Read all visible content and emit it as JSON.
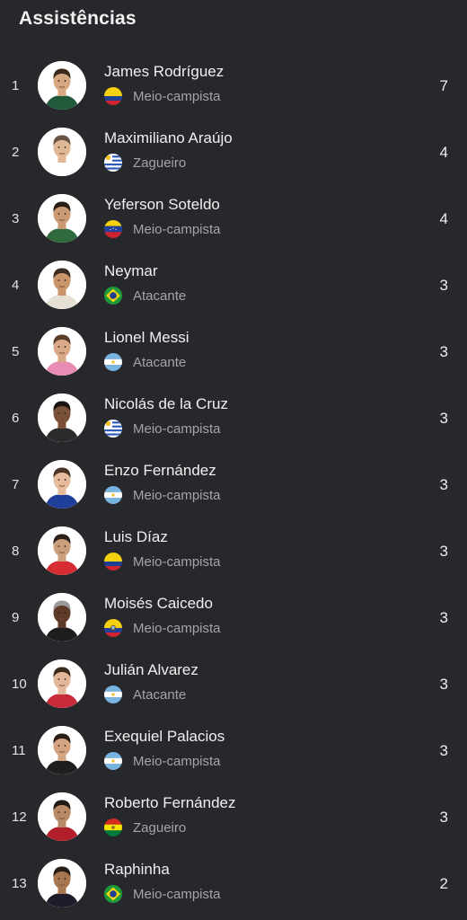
{
  "header": {
    "title": "Assistências"
  },
  "players": [
    {
      "rank": "1",
      "name": "James Rodríguez",
      "position": "Meio-campista",
      "value": "7",
      "country": "colombia",
      "avatar": {
        "skin": "#d7a982",
        "hair": "#3a2a1e",
        "shirt": "#1f5b3a"
      }
    },
    {
      "rank": "2",
      "name": "Maximiliano Araújo",
      "position": "Zagueiro",
      "value": "4",
      "country": "uruguay",
      "avatar": {
        "skin": "#e0b896",
        "hair": "#6b5444",
        "shirt": "#ffffff"
      }
    },
    {
      "rank": "3",
      "name": "Yeferson Soteldo",
      "position": "Meio-campista",
      "value": "4",
      "country": "venezuela",
      "avatar": {
        "skin": "#c99a74",
        "hair": "#2a1e16",
        "shirt": "#2e6a3c"
      }
    },
    {
      "rank": "4",
      "name": "Neymar",
      "position": "Atacante",
      "value": "3",
      "country": "brazil",
      "avatar": {
        "skin": "#c9966c",
        "hair": "#3b2b20",
        "shirt": "#e6e0d4"
      }
    },
    {
      "rank": "5",
      "name": "Lionel Messi",
      "position": "Atacante",
      "value": "3",
      "country": "argentina",
      "avatar": {
        "skin": "#d9a886",
        "hair": "#5a3e2a",
        "shirt": "#e98cb4"
      }
    },
    {
      "rank": "6",
      "name": "Nicolás de la Cruz",
      "position": "Meio-campista",
      "value": "3",
      "country": "uruguay",
      "avatar": {
        "skin": "#7a5138",
        "hair": "#1c1410",
        "shirt": "#2a2a2a"
      }
    },
    {
      "rank": "7",
      "name": "Enzo Fernández",
      "position": "Meio-campista",
      "value": "3",
      "country": "argentina",
      "avatar": {
        "skin": "#e6bc9c",
        "hair": "#4a3526",
        "shirt": "#1f3f9a"
      }
    },
    {
      "rank": "8",
      "name": "Luis Díaz",
      "position": "Meio-campista",
      "value": "3",
      "country": "colombia",
      "avatar": {
        "skin": "#caa07c",
        "hair": "#2b1f18",
        "shirt": "#d72c32"
      }
    },
    {
      "rank": "9",
      "name": "Moisés Caicedo",
      "position": "Meio-campista",
      "value": "3",
      "country": "ecuador",
      "avatar": {
        "skin": "#5e3a28",
        "hair": "#9a9a9a",
        "shirt": "#1d1d1d"
      }
    },
    {
      "rank": "10",
      "name": "Julián Alvarez",
      "position": "Atacante",
      "value": "3",
      "country": "argentina",
      "avatar": {
        "skin": "#e3b898",
        "hair": "#3a2a1e",
        "shirt": "#c92a3a"
      }
    },
    {
      "rank": "11",
      "name": "Exequiel Palacios",
      "position": "Meio-campista",
      "value": "3",
      "country": "argentina",
      "avatar": {
        "skin": "#d4a482",
        "hair": "#2a1e16",
        "shirt": "#1e1e1e"
      }
    },
    {
      "rank": "12",
      "name": "Roberto Fernández",
      "position": "Zagueiro",
      "value": "3",
      "country": "bolivia",
      "avatar": {
        "skin": "#b98a66",
        "hair": "#231913",
        "shirt": "#b21e2a"
      }
    },
    {
      "rank": "13",
      "name": "Raphinha",
      "position": "Meio-campista",
      "value": "2",
      "country": "brazil",
      "avatar": {
        "skin": "#a9774f",
        "hair": "#2a1d15",
        "shirt": "#1c1c2a"
      }
    }
  ],
  "colors": {
    "background": "#26282c",
    "text": "#f0f0f0",
    "muted": "#a3a5aa"
  }
}
